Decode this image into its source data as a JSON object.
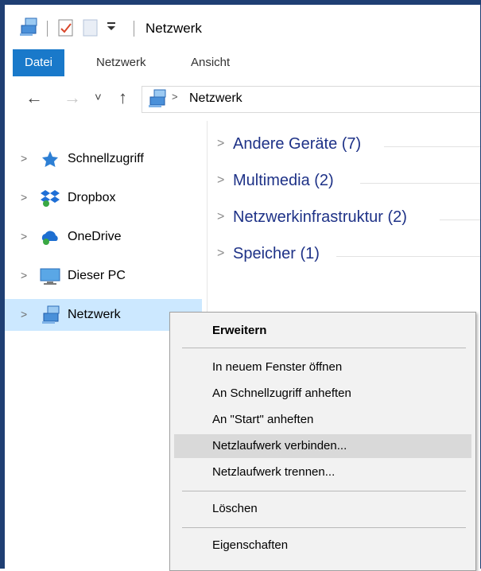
{
  "window": {
    "title": "Netzwerk"
  },
  "ribbon": {
    "tabs": [
      {
        "label": "Datei",
        "active": true
      },
      {
        "label": "Netzwerk",
        "active": false
      },
      {
        "label": "Ansicht",
        "active": false
      }
    ]
  },
  "nav_buttons": {
    "back": "←",
    "forward": "→",
    "recent": "˅",
    "up": "↑"
  },
  "address": {
    "path": "Netzwerk"
  },
  "navpane": {
    "items": [
      {
        "label": "Schnellzugriff",
        "icon": "star-icon"
      },
      {
        "label": "Dropbox",
        "icon": "dropbox-icon"
      },
      {
        "label": "OneDrive",
        "icon": "onedrive-cloud-icon"
      },
      {
        "label": "Dieser PC",
        "icon": "computer-icon"
      },
      {
        "label": "Netzwerk",
        "icon": "network-icon",
        "selected": true
      }
    ]
  },
  "content": {
    "groups": [
      {
        "label": "Andere Geräte (7)"
      },
      {
        "label": "Multimedia (2)"
      },
      {
        "label": "Netzwerkinfrastruktur (2)"
      },
      {
        "label": "Speicher (1)"
      }
    ]
  },
  "context_menu": {
    "items": [
      {
        "label": "Erweitern",
        "bold": true
      },
      {
        "label": "In neuem Fenster öffnen"
      },
      {
        "label": "An Schnellzugriff anheften"
      },
      {
        "label": "An \"Start\" anheften"
      },
      {
        "label": "Netzlaufwerk verbinden...",
        "hover": true
      },
      {
        "label": "Netzlaufwerk trennen..."
      },
      {
        "label": "Löschen"
      },
      {
        "label": "Eigenschaften"
      }
    ]
  },
  "colors": {
    "accent": "#1979ca",
    "selection": "#cce8ff",
    "group_text": "#1e3287",
    "window_border": "#1f3f73"
  }
}
